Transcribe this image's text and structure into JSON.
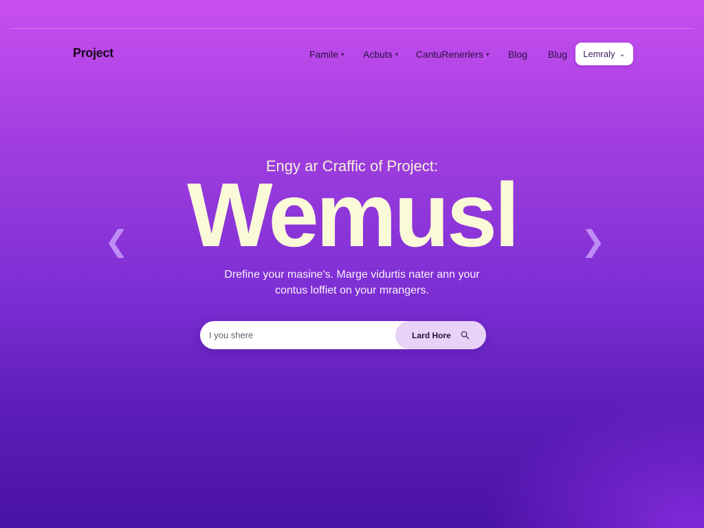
{
  "brand": {
    "logo": "Project"
  },
  "nav": {
    "items": [
      {
        "label": "Famile",
        "has_dropdown": true
      },
      {
        "label": "Acbuts",
        "has_dropdown": true
      },
      {
        "label": "CantuRenerlers",
        "has_dropdown": true
      },
      {
        "label": "Blog",
        "has_dropdown": false
      },
      {
        "label": "Blug",
        "has_dropdown": false
      }
    ],
    "cta_label": "Lemraly"
  },
  "hero": {
    "eyebrow": "Engy ar Craffic of Project:",
    "headline": "Wemusl",
    "description_line1": "Drefine your masine's. Marge vidurtis nater ann your",
    "description_line2": "contus loffiet on your mrangers."
  },
  "search": {
    "placeholder": "I you shere",
    "button_label": "Lard Hore"
  },
  "icons": {
    "carousel_prev": "chevron-left-icon",
    "carousel_next": "chevron-right-icon",
    "search": "search-icon"
  },
  "colors": {
    "background_top": "#c94ff0",
    "background_bottom": "#4a12a6",
    "headline": "#fbfad8",
    "search_button": "#e8d2f6"
  }
}
